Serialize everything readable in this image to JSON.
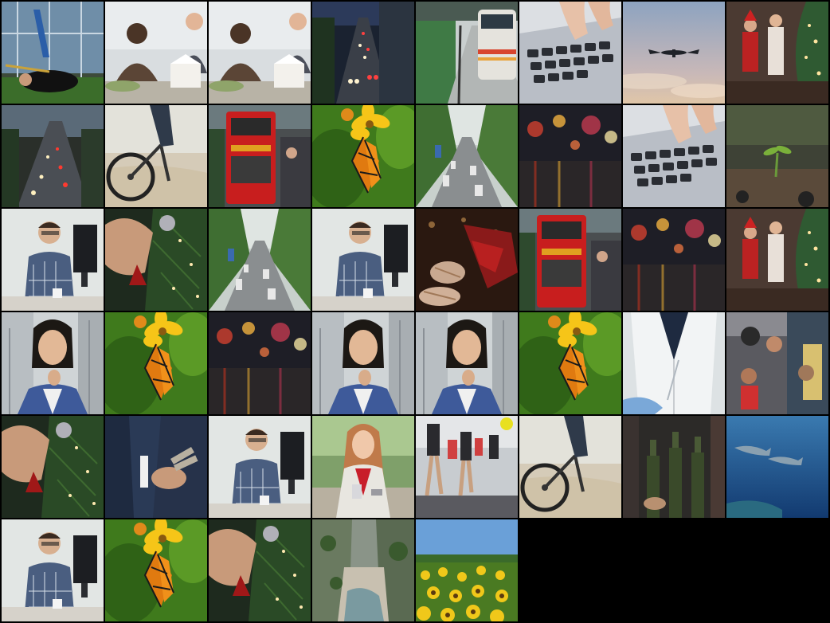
{
  "tiles": [
    {
      "kind": "gym",
      "name": "gym-workout-thumbnail"
    },
    {
      "kind": "meeting",
      "name": "office-meeting-thumbnail"
    },
    {
      "kind": "meeting",
      "name": "office-meeting-thumbnail"
    },
    {
      "kind": "traffic-night",
      "name": "night-traffic-thumbnail"
    },
    {
      "kind": "train",
      "name": "train-station-thumbnail"
    },
    {
      "kind": "keyboard",
      "name": "laptop-typing-thumbnail"
    },
    {
      "kind": "airplane",
      "name": "airplane-sky-thumbnail"
    },
    {
      "kind": "christmas-family",
      "name": "christmas-family-thumbnail"
    },
    {
      "kind": "traffic-evening",
      "name": "evening-traffic-thumbnail"
    },
    {
      "kind": "bike",
      "name": "mountain-bike-thumbnail"
    },
    {
      "kind": "bus",
      "name": "double-decker-bus-thumbnail"
    },
    {
      "kind": "butterfly",
      "name": "butterfly-flower-thumbnail"
    },
    {
      "kind": "road-trees",
      "name": "tree-lined-road-thumbnail"
    },
    {
      "kind": "rain-lights",
      "name": "rainy-street-lights-thumbnail"
    },
    {
      "kind": "keyboard",
      "name": "laptop-typing-thumbnail"
    },
    {
      "kind": "seedling",
      "name": "seedling-soil-thumbnail"
    },
    {
      "kind": "man-desk",
      "name": "man-at-desk-thumbnail"
    },
    {
      "kind": "ornament",
      "name": "christmas-ornament-thumbnail"
    },
    {
      "kind": "road-trees",
      "name": "tree-lined-road-thumbnail"
    },
    {
      "kind": "man-desk",
      "name": "man-at-desk-thumbnail"
    },
    {
      "kind": "socks",
      "name": "cozy-socks-thumbnail"
    },
    {
      "kind": "bus",
      "name": "double-decker-bus-thumbnail"
    },
    {
      "kind": "rain-lights",
      "name": "rainy-street-lights-thumbnail"
    },
    {
      "kind": "christmas-family",
      "name": "christmas-family-thumbnail"
    },
    {
      "kind": "woman-thinking",
      "name": "woman-thinking-thumbnail"
    },
    {
      "kind": "butterfly",
      "name": "butterfly-flower-thumbnail"
    },
    {
      "kind": "rain-lights",
      "name": "rainy-street-lights-thumbnail"
    },
    {
      "kind": "woman-thinking",
      "name": "woman-thinking-thumbnail"
    },
    {
      "kind": "woman-thinking",
      "name": "woman-thinking-thumbnail"
    },
    {
      "kind": "butterfly",
      "name": "butterfly-flower-thumbnail"
    },
    {
      "kind": "lab",
      "name": "lab-coat-thumbnail"
    },
    {
      "kind": "kids-bus",
      "name": "children-on-bus-thumbnail"
    },
    {
      "kind": "ornament",
      "name": "christmas-ornament-thumbnail"
    },
    {
      "kind": "money",
      "name": "counting-money-thumbnail"
    },
    {
      "kind": "man-desk",
      "name": "man-at-desk-thumbnail"
    },
    {
      "kind": "woman-phone",
      "name": "woman-with-phone-thumbnail"
    },
    {
      "kind": "marathon",
      "name": "marathon-runners-thumbnail"
    },
    {
      "kind": "bike",
      "name": "mountain-bike-thumbnail"
    },
    {
      "kind": "bottles",
      "name": "bottles-thumbnail"
    },
    {
      "kind": "sharks",
      "name": "sharks-underwater-thumbnail"
    },
    {
      "kind": "man-desk",
      "name": "man-at-desk-thumbnail"
    },
    {
      "kind": "butterfly",
      "name": "butterfly-flower-thumbnail"
    },
    {
      "kind": "ornament",
      "name": "christmas-ornament-thumbnail"
    },
    {
      "kind": "canyon",
      "name": "canyon-stream-thumbnail"
    },
    {
      "kind": "sunflowers",
      "name": "sunflower-field-thumbnail"
    }
  ]
}
